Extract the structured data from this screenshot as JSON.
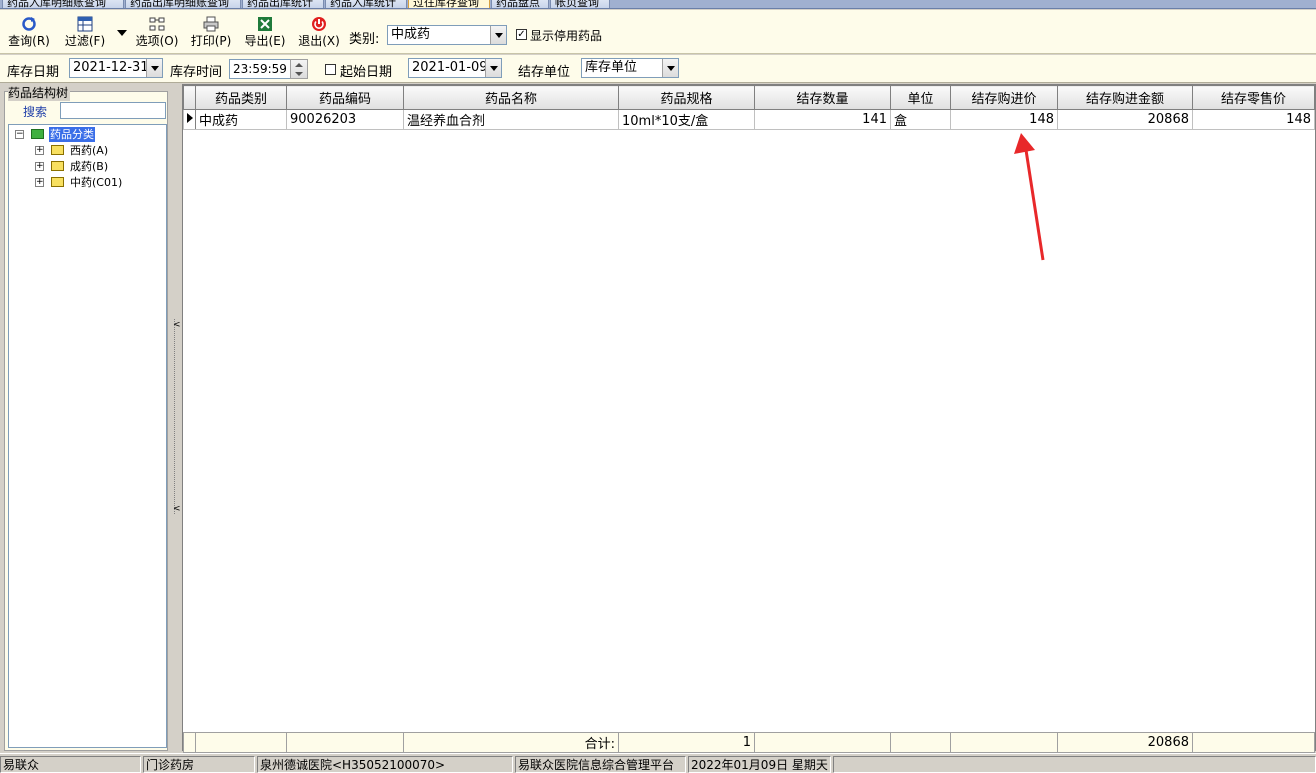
{
  "tabs": [
    {
      "label": "药品入库明细账查询",
      "active": false
    },
    {
      "label": "药品出库明细账查询",
      "active": false
    },
    {
      "label": "药品出库统计",
      "active": false
    },
    {
      "label": "药品入库统计",
      "active": false
    },
    {
      "label": "过往库存查询",
      "active": true
    },
    {
      "label": "药品盘点",
      "active": false
    },
    {
      "label": "帐页查询",
      "active": false
    }
  ],
  "toolbar": {
    "query": "查询(R)",
    "filter": "过滤(F)",
    "options": "选项(O)",
    "print": "打印(P)",
    "export": "导出(E)",
    "exit": "退出(X)",
    "category_label": "类别:",
    "category_value": "中成药",
    "show_disabled_label": "显示停用药品",
    "show_disabled_checked": true
  },
  "filterbar": {
    "stock_date_label": "库存日期",
    "stock_date_value": "2021-12-31",
    "stock_time_label": "库存时间",
    "stock_time_value": "23:59:59",
    "start_date_label": "起始日期",
    "start_date_checked": false,
    "start_date_value": "2021-01-09",
    "unit_label": "结存单位",
    "unit_value": "库存单位"
  },
  "leftpane": {
    "title": "药品结构树",
    "search_label": "搜索",
    "search_value": "",
    "tree": {
      "root": "药品分类",
      "children": [
        "西药(A)",
        "成药(B)",
        "中药(C01)"
      ]
    }
  },
  "grid": {
    "columns": [
      "药品类别",
      "药品编码",
      "药品名称",
      "药品规格",
      "结存数量",
      "单位",
      "结存购进价",
      "结存购进金额",
      "结存零售价"
    ],
    "rows": [
      {
        "category": "中成药",
        "code": "90026203",
        "name": "温经养血合剂",
        "spec": "10ml*10支/盒",
        "qty": "141",
        "unit": "盒",
        "purchase_price": "148",
        "purchase_amount": "20868",
        "retail_price": "148"
      }
    ],
    "footer": {
      "label": "合计:",
      "count": "1",
      "amount": "20868"
    }
  },
  "statusbar": {
    "app": "易联众",
    "dept": "门诊药房",
    "hospital": "泉州德诚医院<H35052100070>",
    "platform": "易联众医院信息综合管理平台",
    "date": "2022年01月09日  星期天"
  },
  "colors": {
    "toolbar_bg": "#fefcea",
    "selection": "#3a6ee8",
    "annotation_arrow": "#e8282a"
  }
}
